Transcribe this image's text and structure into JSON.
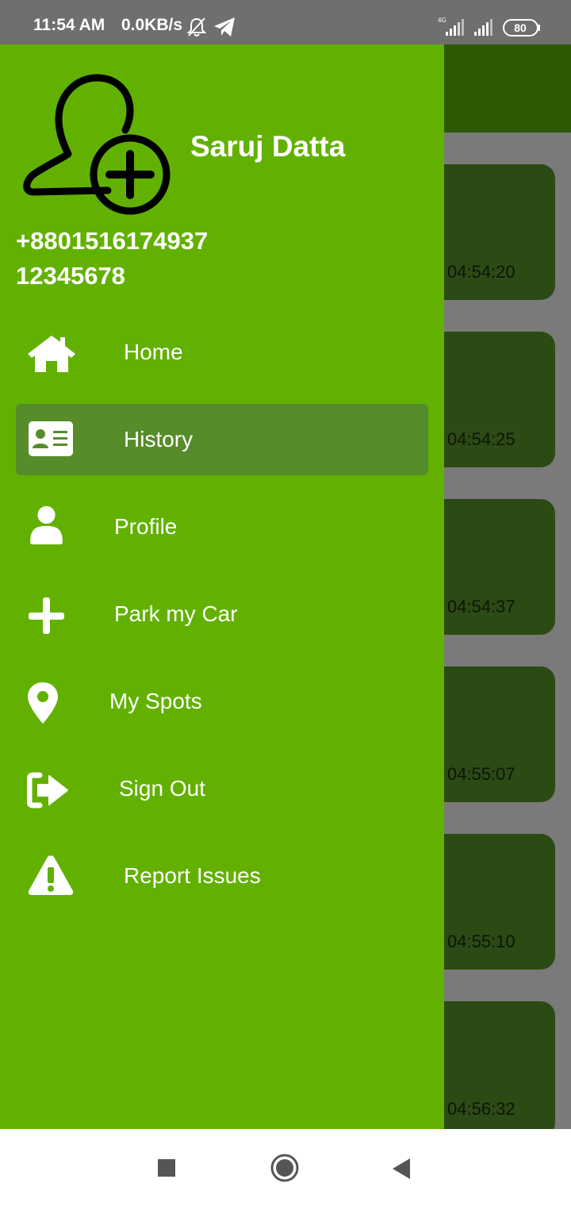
{
  "status_bar": {
    "time": "11:54 AM",
    "network_speed": "0.0KB/s",
    "network_type": "4G",
    "battery": "80"
  },
  "history_times": [
    "04:54:20",
    "04:54:25",
    "04:54:37",
    "04:55:07",
    "04:55:10",
    "04:56:32"
  ],
  "drawer": {
    "user_name": "Saruj Datta",
    "phone": "+8801516174937",
    "user_id": "12345678",
    "menu": [
      {
        "label": "Home",
        "icon": "home-icon"
      },
      {
        "label": "History",
        "icon": "id-card-icon",
        "active": true
      },
      {
        "label": "Profile",
        "icon": "user-icon"
      },
      {
        "label": "Park my Car",
        "icon": "plus-icon"
      },
      {
        "label": "My Spots",
        "icon": "map-pin-icon"
      },
      {
        "label": "Sign Out",
        "icon": "sign-out-icon"
      },
      {
        "label": "Report Issues",
        "icon": "warning-icon"
      }
    ]
  },
  "colors": {
    "drawer_bg": "#62b100",
    "active_item_bg": "#568c2a",
    "toolbar": "#2d5a00",
    "card": "#2c4a14"
  }
}
